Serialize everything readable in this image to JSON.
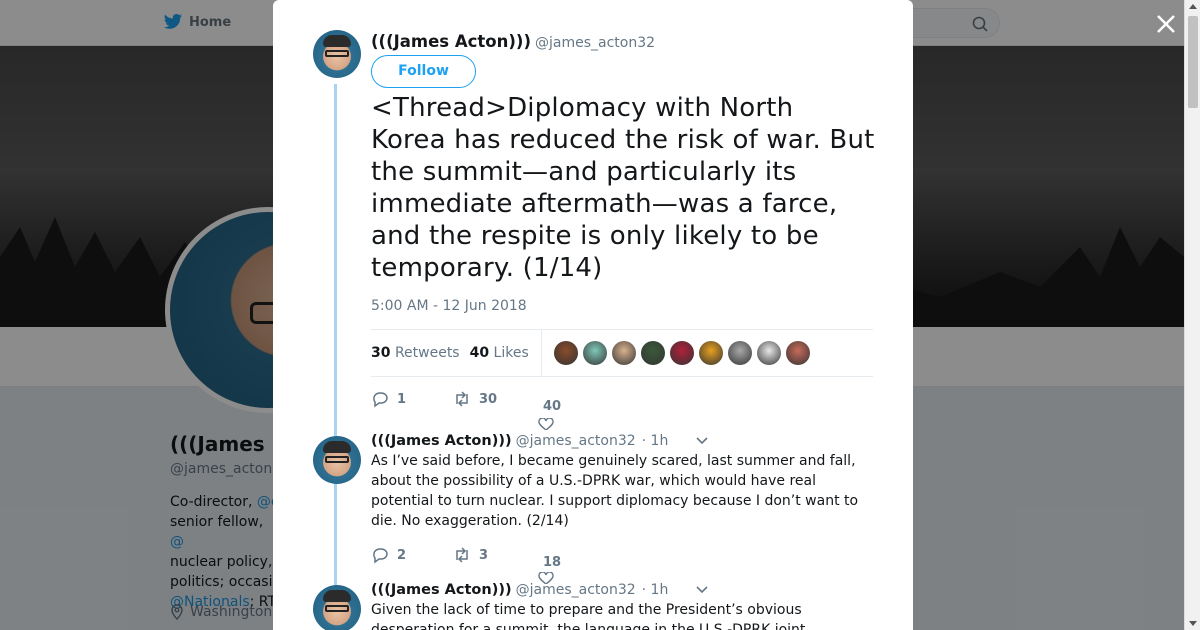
{
  "nav": {
    "home_label": "Home"
  },
  "profile": {
    "name": "(((James",
    "handle": "@james_acton",
    "bio_line1": "Co-director, ",
    "bio_link1": "@c",
    "bio_line2": "senior fellow, ",
    "bio_link2": "@",
    "bio_line3": "nuclear policy,",
    "bio_line4": "politics; occasi",
    "bio_link3": "@Nationals",
    "bio_line5": "; RT",
    "location": "Washington"
  },
  "main_tweet": {
    "name": "(((James Acton)))",
    "handle": "@james_acton32",
    "follow_label": "Follow",
    "text": "<Thread>Diplomacy with North Korea has reduced the risk of war. But the summit—and particularly its immediate aftermath—was a farce, and the respite is only likely to be temporary. (1/14)",
    "timestamp": "5:00 AM - 12 Jun 2018",
    "retweets_count": "30",
    "retweets_label": "Retweets",
    "likes_count": "40",
    "likes_label": "Likes",
    "likers_colors": [
      "#8a4b2a",
      "#7fc8b8",
      "#d9b28e",
      "#3a5a3a",
      "#b0203a",
      "#e8a020",
      "#a8a8a8",
      "#e8e8e8",
      "#c86a5a"
    ],
    "reply_count": "1",
    "retweet_count": "30",
    "like_count": "40"
  },
  "replies": [
    {
      "name": "(((James Acton)))",
      "handle": "@james_acton32",
      "time": "· 1h",
      "text": "As I’ve said before, I became genuinely scared, last summer and fall, about the possibility of a U.S.-DPRK war, which would have real potential to turn nuclear. I support diplomacy because I don’t want to die. No exaggeration. (2/14)",
      "reply_count": "2",
      "retweet_count": "3",
      "like_count": "18"
    },
    {
      "name": "(((James Acton)))",
      "handle": "@james_acton32",
      "time": "· 1h",
      "text": "Given the lack of time to prepare and the President’s obvious desperation for a summit, the language in the U.S.-DPRK joint"
    }
  ]
}
